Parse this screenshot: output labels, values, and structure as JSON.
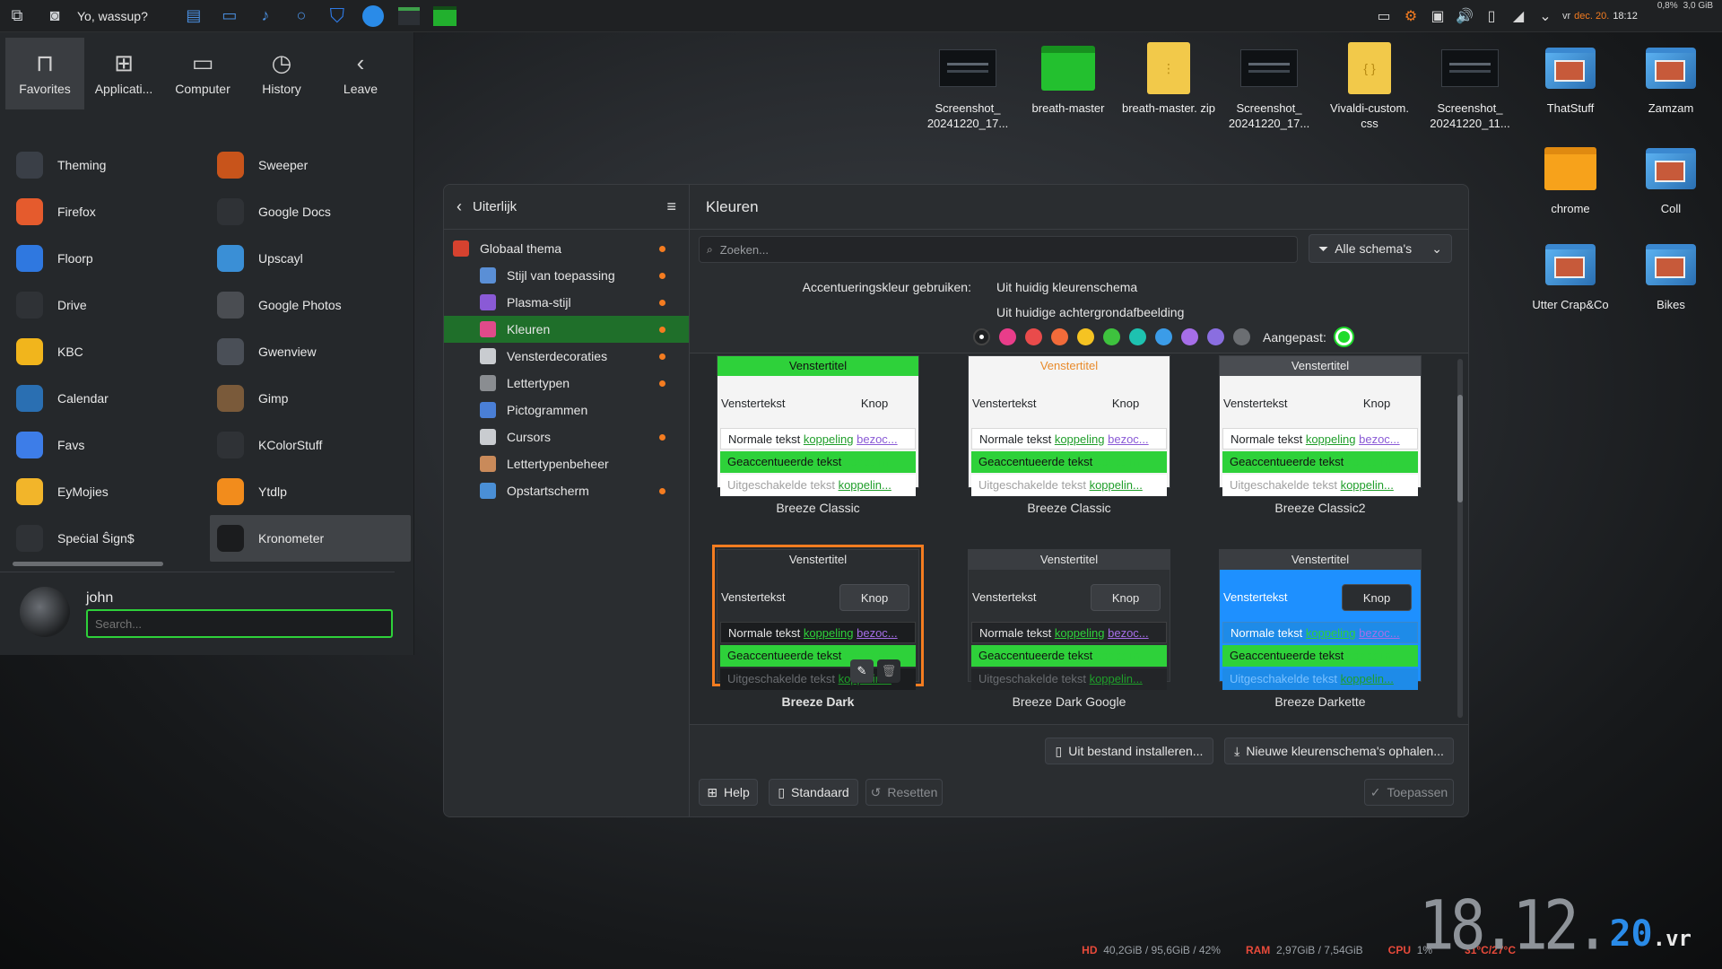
{
  "panel": {
    "greeting": "Yo, wassup?",
    "tray": {
      "cpu_pct": "0,8%",
      "mem": "3,0 GiB",
      "locale": "vr",
      "date": "dec. 20.",
      "time": "18:12"
    }
  },
  "launcher": {
    "tabs": [
      {
        "label": "Favorites",
        "icon": "bookmark-icon"
      },
      {
        "label": "Applicati...",
        "icon": "grid-icon"
      },
      {
        "label": "Computer",
        "icon": "monitor-icon"
      },
      {
        "label": "History",
        "icon": "clock-icon"
      },
      {
        "label": "Leave",
        "icon": "leave-icon"
      }
    ],
    "apps": [
      {
        "label": "Theming",
        "icon": "theming-icon",
        "color": "#3a3f47"
      },
      {
        "label": "Sweeper",
        "icon": "sweeper-icon",
        "color": "#c8541b"
      },
      {
        "label": "Firefox",
        "icon": "firefox-icon",
        "color": "#e55b2d"
      },
      {
        "label": "Google Docs",
        "icon": "google-docs-icon",
        "color": "#2f3236"
      },
      {
        "label": "Floorp",
        "icon": "floorp-icon",
        "color": "#2f78e0"
      },
      {
        "label": "Upscayl",
        "icon": "upscayl-icon",
        "color": "#3a8fd6"
      },
      {
        "label": "Drive",
        "icon": "drive-icon",
        "color": "#2f3236"
      },
      {
        "label": "Google Photos",
        "icon": "google-photos-icon",
        "color": "#4a4d52"
      },
      {
        "label": "KBC",
        "icon": "kbc-icon",
        "color": "#f1b51c"
      },
      {
        "label": "Gwenview",
        "icon": "gwenview-icon",
        "color": "#4a4f57"
      },
      {
        "label": "Calendar",
        "icon": "calendar-icon",
        "color": "#2a6fb2"
      },
      {
        "label": "Gimp",
        "icon": "gimp-icon",
        "color": "#7a5a3a"
      },
      {
        "label": "Favs",
        "icon": "favs-icon",
        "color": "#3d7de8"
      },
      {
        "label": "KColorStuff",
        "icon": "kcolorstuff-icon",
        "color": "#2f3236"
      },
      {
        "label": "EyMojies",
        "icon": "emoji-icon",
        "color": "#f2b52a"
      },
      {
        "label": "Ytdlp",
        "icon": "ytdlp-icon",
        "color": "#f28c1c"
      },
      {
        "label": "Speċial Ŝign$",
        "icon": "special-sign-icon",
        "color": "#2f3236"
      },
      {
        "label": "Kronometer",
        "icon": "kronometer-icon",
        "color": "#1b1c1e"
      }
    ],
    "user": "john",
    "search_placeholder": "Search..."
  },
  "desktop": [
    {
      "label": "Screenshot_ 20241220_17...",
      "icon": "screenshot-thumbnail-icon"
    },
    {
      "label": "breath-master",
      "icon": "green-folder-icon"
    },
    {
      "label": "breath-master. zip",
      "icon": "zip-file-icon"
    },
    {
      "label": "Screenshot_ 20241220_17...",
      "icon": "screenshot-thumbnail-icon"
    },
    {
      "label": "Vivaldi-custom. css",
      "icon": "css-file-icon"
    },
    {
      "label": "Screenshot_ 20241220_11...",
      "icon": "screenshot-thumbnail-icon"
    },
    {
      "label": "ThatStuff",
      "icon": "photo-folder-icon"
    },
    {
      "label": "Zamzam",
      "icon": "photo-folder-icon"
    },
    {
      "label": "chrome",
      "icon": "orange-folder-icon"
    },
    {
      "label": "Coll",
      "icon": "photo-folder-icon"
    },
    {
      "label": "Utter Crap&Co",
      "icon": "photo-folder-icon"
    },
    {
      "label": "Bikes",
      "icon": "photo-folder-icon"
    }
  ],
  "settings": {
    "sidebar_title": "Uiterlijk",
    "items": [
      {
        "label": "Globaal thema",
        "modified": true
      },
      {
        "label": "Stijl van toepassing",
        "modified": true
      },
      {
        "label": "Plasma-stijl",
        "modified": true
      },
      {
        "label": "Kleuren",
        "modified": true
      },
      {
        "label": "Vensterdecoraties",
        "modified": true
      },
      {
        "label": "Lettertypen",
        "modified": true
      },
      {
        "label": "Pictogrammen",
        "modified": false
      },
      {
        "label": "Cursors",
        "modified": true
      },
      {
        "label": "Lettertypenbeheer",
        "modified": false
      },
      {
        "label": "Opstartscherm",
        "modified": true
      }
    ],
    "page_title": "Kleuren",
    "search_placeholder": "Zoeken...",
    "filter_label": "Alle schema's",
    "accent_label": "Accentueringskleur gebruiken:",
    "accent_opt1": "Uit huidig kleurenschema",
    "accent_opt2": "Uit huidige achtergrondafbeelding",
    "custom_label": "Aangepast:",
    "swatches": [
      "#e93d8a",
      "#e94b4b",
      "#f26b3a",
      "#f5c322",
      "#3ec23e",
      "#1ec2b0",
      "#3b9ce8",
      "#a66ee8",
      "#8a6ee0",
      "#6b6e72"
    ],
    "sample": {
      "title": "Venstertitel",
      "text": "Venstertekst",
      "button": "Knop",
      "normal": "Normale tekst",
      "link": "koppeling",
      "visited": "bezoc...",
      "accent": "Geaccentueerde tekst",
      "accent_link": "koppelin...",
      "disabled": "Uitgeschakelde tekst",
      "disabled_link": "koppelin..."
    },
    "schemes": [
      "Breeze Classic",
      "Breeze Classic",
      "Breeze Classic2",
      "Breeze Dark",
      "Breeze Dark Google",
      "Breeze Darkette"
    ],
    "install_label": "Uit bestand installeren...",
    "get_new_label": "Nieuwe kleurenschema's ophalen...",
    "help_label": "Help",
    "default_label": "Standaard",
    "reset_label": "Resetten",
    "apply_label": "Toepassen"
  },
  "stats": {
    "hd_label": "HD",
    "hd": "40,2GiB / 95,6GiB / 42%",
    "ram_label": "RAM",
    "ram": "2,97GiB / 7,54GiB",
    "cpu_label": "CPU",
    "cpu": "1%",
    "temp": "31°C/27°C"
  },
  "clock": {
    "main": "18.12.",
    "year": "20",
    "suffix": ".vr"
  }
}
